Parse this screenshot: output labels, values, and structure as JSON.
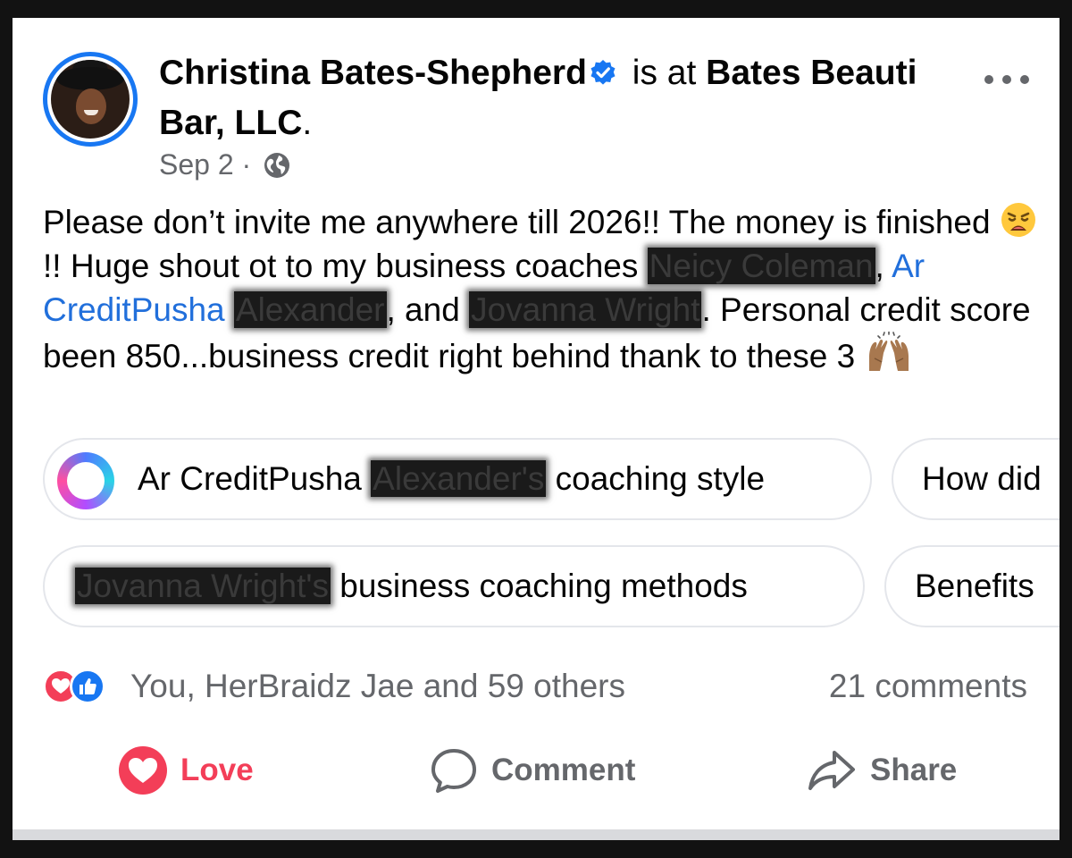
{
  "post": {
    "author": "Christina Bates-Shepherd",
    "checkin_prefix": "is at",
    "place": "Bates Beauti Bar, LLC",
    "place_suffix": ".",
    "date": "Sep 2",
    "date_separator": "·",
    "text": {
      "p1": "Please don’t invite me anywhere till 2026!! The money is finished ",
      "p2": "!!  Huge shout ot to my business coaches ",
      "redacted1": "Neicy Coleman",
      "sep1": ", ",
      "link1": "Ar CreditPusha ",
      "redacted2": "Alexander",
      "sep2": ", and ",
      "redacted3": "Jovanna Wright",
      "p3": ". Personal credit score been 850...business credit right behind thank to these 3 "
    }
  },
  "suggestions": [
    {
      "pre": "Ar CreditPusha ",
      "redacted": "Alexander's",
      "post": " coaching style"
    },
    {
      "text": "How did"
    },
    {
      "redacted": "Jovanna Wright's",
      "post": " business coaching methods"
    },
    {
      "text": "Benefits"
    }
  ],
  "engagement": {
    "reactors": "You, HerBraidz Jae and 59 others",
    "comments": "21 comments"
  },
  "actions": {
    "love": "Love",
    "comment": "Comment",
    "share": "Share"
  },
  "colors": {
    "brand_blue": "#1877f2",
    "love_red": "#f33e58",
    "secondary_text": "#65676b",
    "link": "#216fdb"
  },
  "icons": [
    "verified-badge-icon",
    "more-options-icon",
    "globe-icon",
    "weary-face-emoji",
    "raising-hands-emoji",
    "ai-ring-icon",
    "love-reaction-icon",
    "like-reaction-icon",
    "heart-icon",
    "comment-bubble-icon",
    "share-arrow-icon"
  ]
}
